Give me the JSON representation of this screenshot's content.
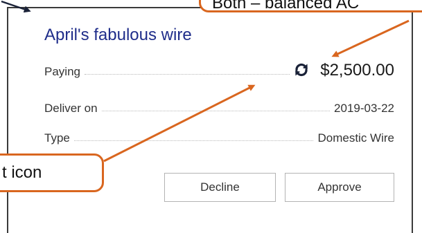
{
  "card": {
    "title": "April's fabulous wire",
    "paying_label": "Paying",
    "amount": "$2,500.00",
    "amount_icon": "recurring-payment-icon",
    "deliver_label": "Deliver on",
    "deliver_date": "2019-03-22",
    "type_label": "Type",
    "type_value": "Domestic Wire",
    "decline_label": "Decline",
    "approve_label": "Approve"
  },
  "annotations": {
    "top_callout": "Both – balanced AC",
    "left_callout": "t icon",
    "accent_color": "#d9661f"
  },
  "colors": {
    "title": "#1f2d8a",
    "text": "#333333",
    "button_border": "#b3b3b3"
  }
}
